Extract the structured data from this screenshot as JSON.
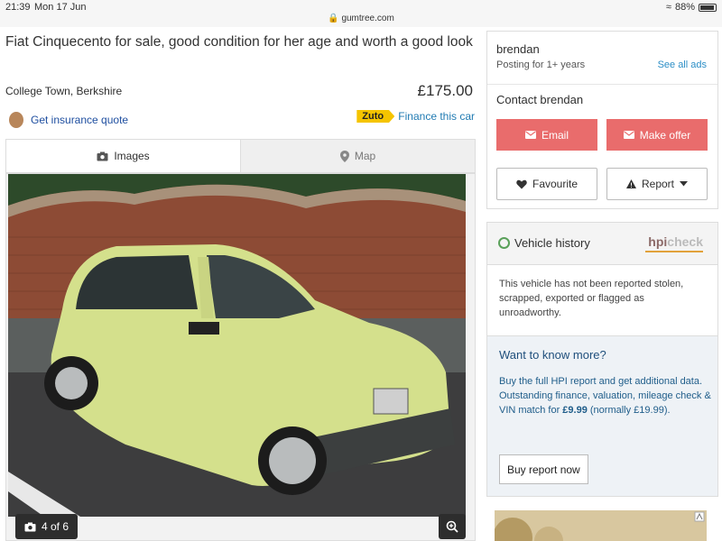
{
  "status_bar": {
    "time": "21:39",
    "date": "Mon 17 Jun",
    "url": "gumtree.com",
    "battery": "88%"
  },
  "listing": {
    "title": "Fiat Cinquecento for sale, good condition for her age and worth a good look",
    "location": "College Town, Berkshire",
    "price": "£175.00",
    "insurance_link": "Get insurance quote",
    "finance_brand": "Zuto",
    "finance_link": "Finance this car"
  },
  "media_tabs": [
    {
      "label": "Images",
      "icon": "camera-icon",
      "active": true
    },
    {
      "label": "Map",
      "icon": "map-pin-icon",
      "active": false
    }
  ],
  "gallery": {
    "counter": "4 of 6"
  },
  "seller_card": {
    "name": "brendan",
    "posting_for": "Posting for 1+ years",
    "see_all": "See all ads",
    "contact_heading": "Contact brendan",
    "email_label": "Email",
    "offer_label": "Make offer",
    "favourite_label": "Favourite",
    "report_label": "Report"
  },
  "vehicle_history": {
    "title": "Vehicle history",
    "brand_hpi": "hpi",
    "brand_check": "check",
    "body": "This vehicle has not been reported stolen, scrapped, exported or flagged as unroadworthy.",
    "want_title": "Want to know more?",
    "want_line1": "Buy the full HPI report and get additional data.",
    "want_line2_prefix": "Outstanding finance, valuation, mileage check & VIN match for ",
    "want_price": "£9.99",
    "want_line2_suffix": " (normally £19.99).",
    "buy_label": "Buy report now"
  },
  "colors": {
    "accent_red": "#e96c6c",
    "link_blue": "#2b8ec6",
    "hpi_orange": "#e2a23b"
  }
}
